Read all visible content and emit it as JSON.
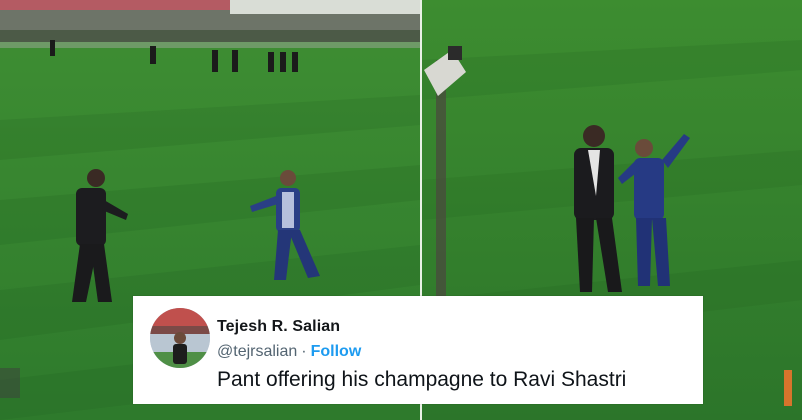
{
  "tweet": {
    "author_name": "Tejesh R. Salian",
    "author_handle": "@tejrsalian",
    "separator": "·",
    "follow_label": "Follow",
    "text": "Pant offering his champagne to Ravi Shastri"
  },
  "colors": {
    "pitch": "#2f7d2f",
    "follow": "#1d9bf0",
    "card": "#ffffff"
  }
}
